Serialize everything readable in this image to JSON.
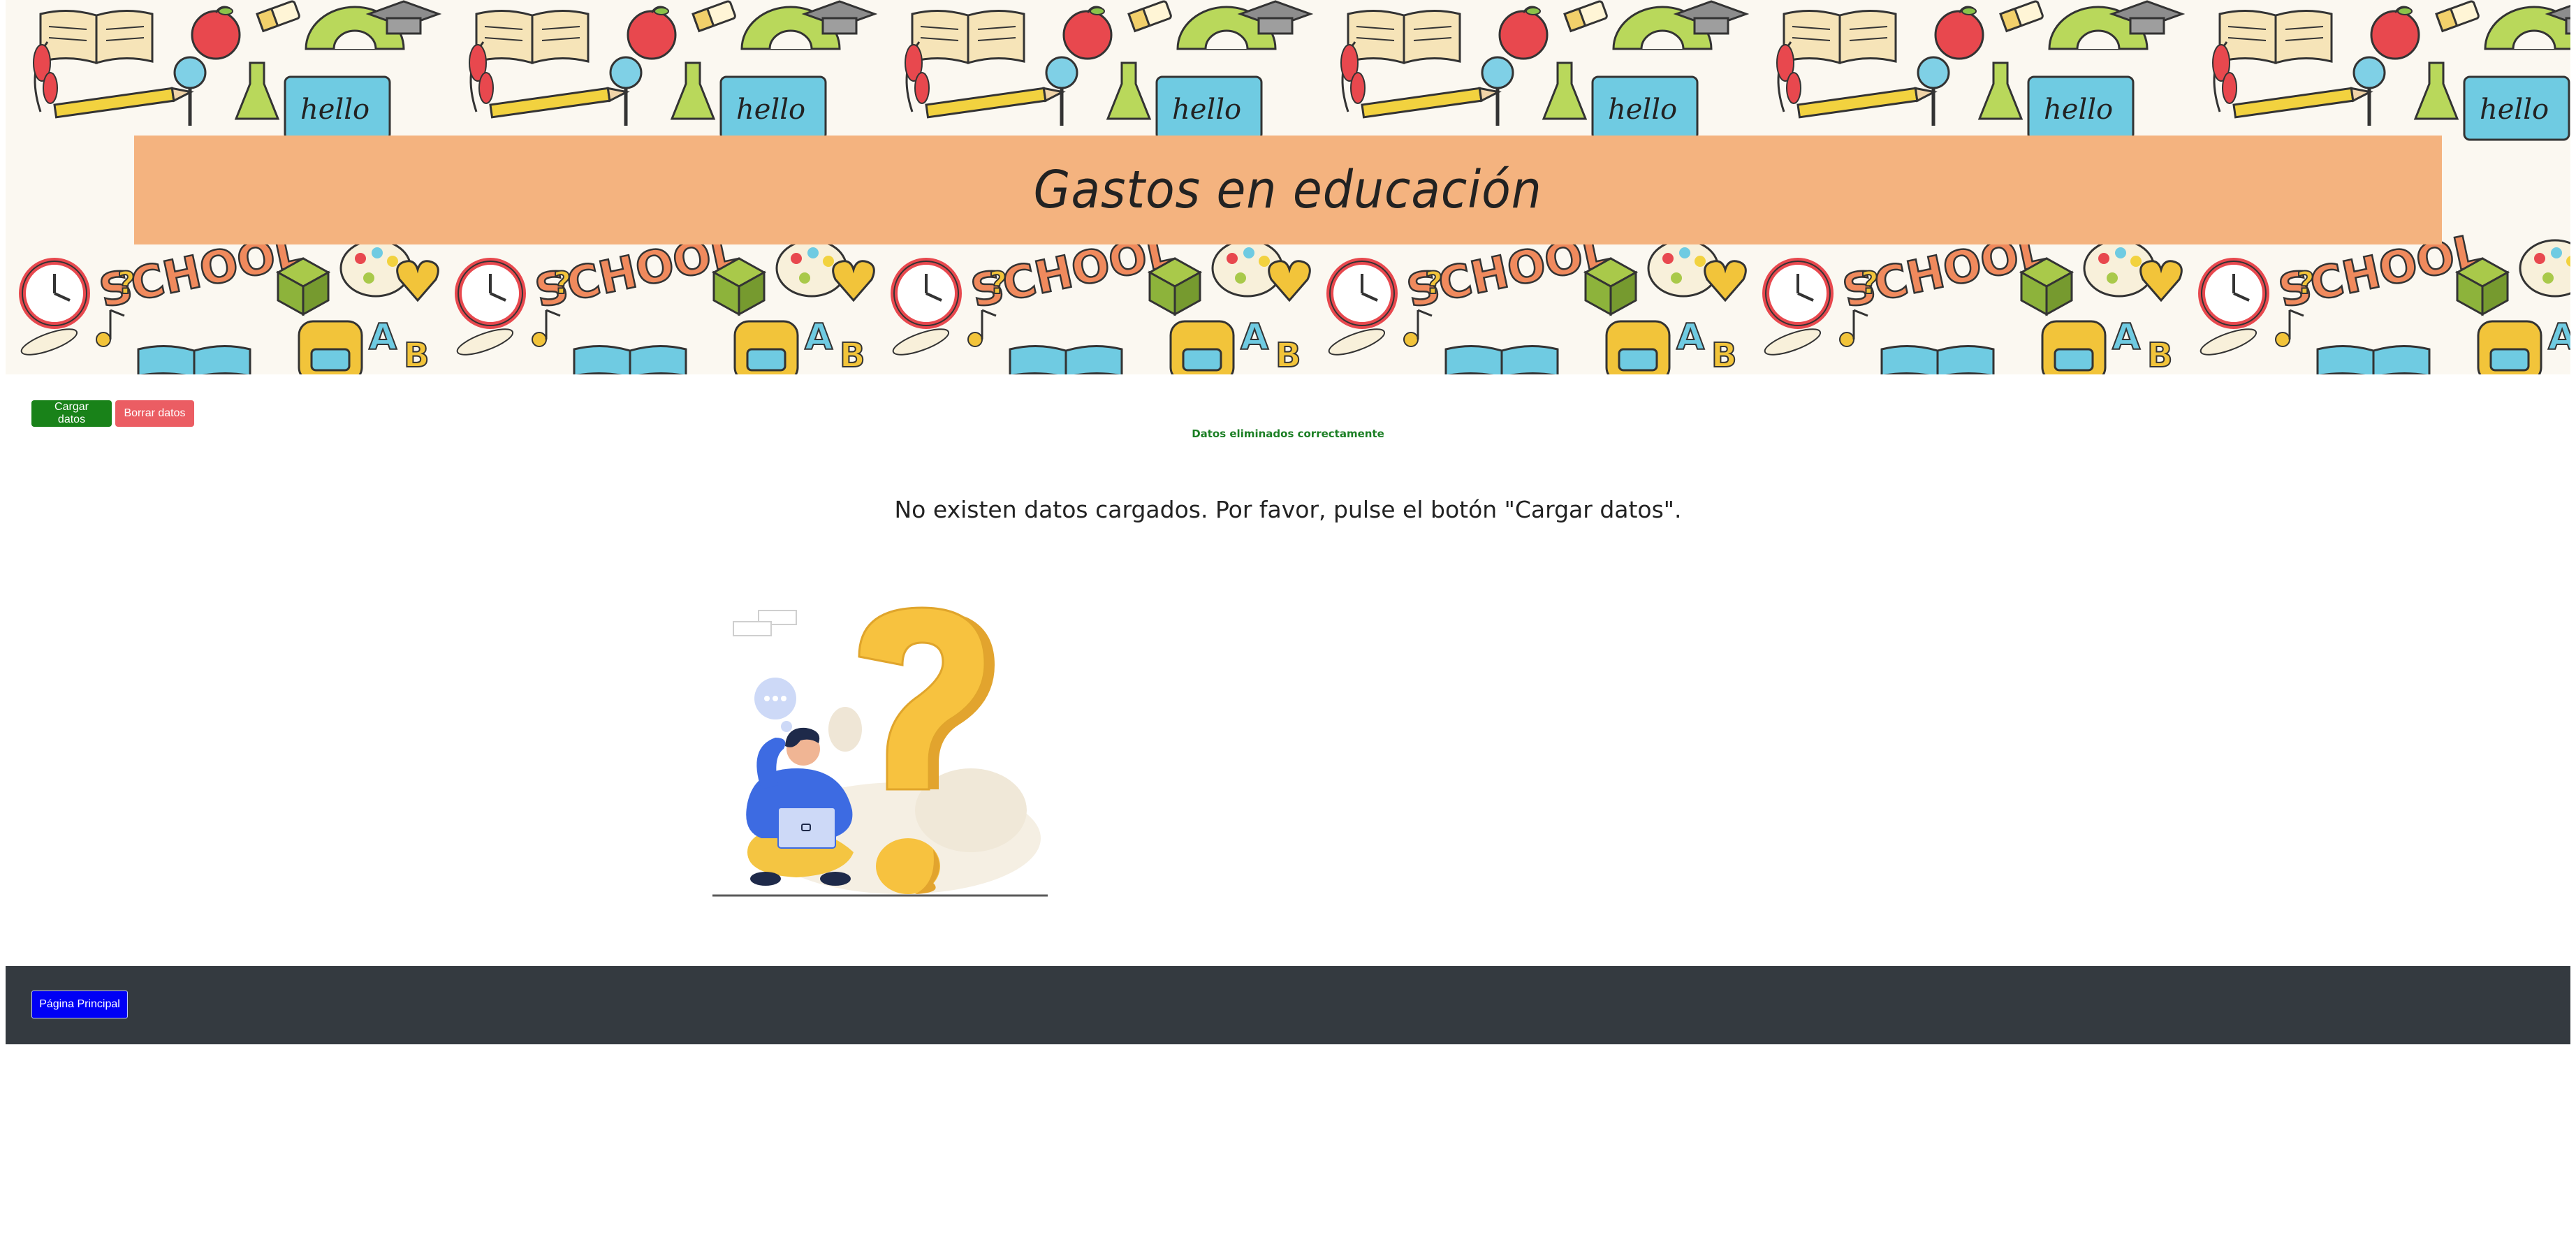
{
  "header": {
    "title": "Gastos en educación",
    "banner_pattern": "school-doodles",
    "title_bg_color": "#f4b37f"
  },
  "actions": {
    "load_label": "Cargar datos",
    "load_color": "#198219",
    "delete_label": "Borrar datos",
    "delete_color": "#eb5d63"
  },
  "status": {
    "message": "Datos eliminados correctamente",
    "color": "#1b7f24"
  },
  "main": {
    "empty_message": "No existen datos cargados. Por favor, pulse el botón \"Cargar datos\".",
    "illustration": "person-with-laptop-question-mark"
  },
  "footer": {
    "home_label": "Página Principal",
    "bg_color": "#343a40",
    "home_color": "#0000f5"
  }
}
